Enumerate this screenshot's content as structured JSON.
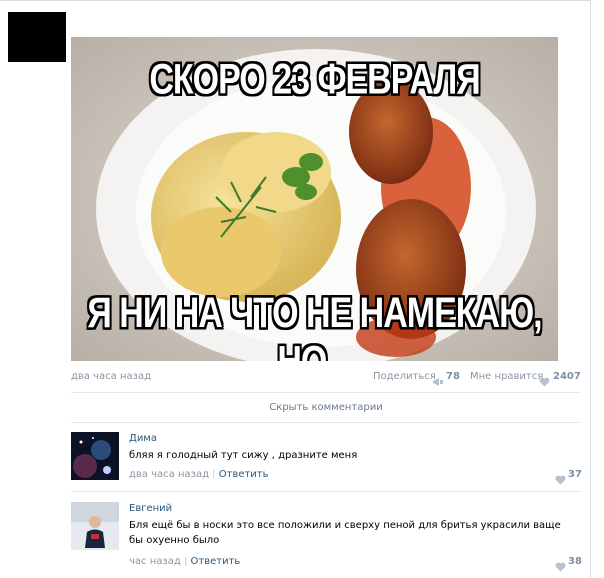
{
  "post": {
    "meme_top_text": "СКОРО 23 ФЕВРАЛЯ",
    "meme_bottom_text": "Я НИ НА ЧТО НЕ НАМЕКАЮ, НО...",
    "time": "два часа назад",
    "share_label": "Поделиться",
    "share_count": "78",
    "like_label": "Мне нравится",
    "like_count": "2407",
    "hide_comments_label": "Скрыть комментарии"
  },
  "comments": [
    {
      "author": "Дима",
      "text": "бляя я голодный тут сижу , дразните меня",
      "time": "два часа назад",
      "separator": "|",
      "reply_label": "Ответить",
      "likes": "37"
    },
    {
      "author": "Евгений",
      "text": "Бля ещё бы в носки это все положили и сверху пеной для бритья украсили ваще бы охуенно было",
      "time": "час назад",
      "separator": "|",
      "reply_label": "Ответить",
      "likes": "38"
    }
  ],
  "icons": {
    "share": "megaphone-icon",
    "like": "heart-icon"
  },
  "colors": {
    "link": "#2b587a",
    "meta": "#8a95a3",
    "counter": "#7e8fa6"
  }
}
